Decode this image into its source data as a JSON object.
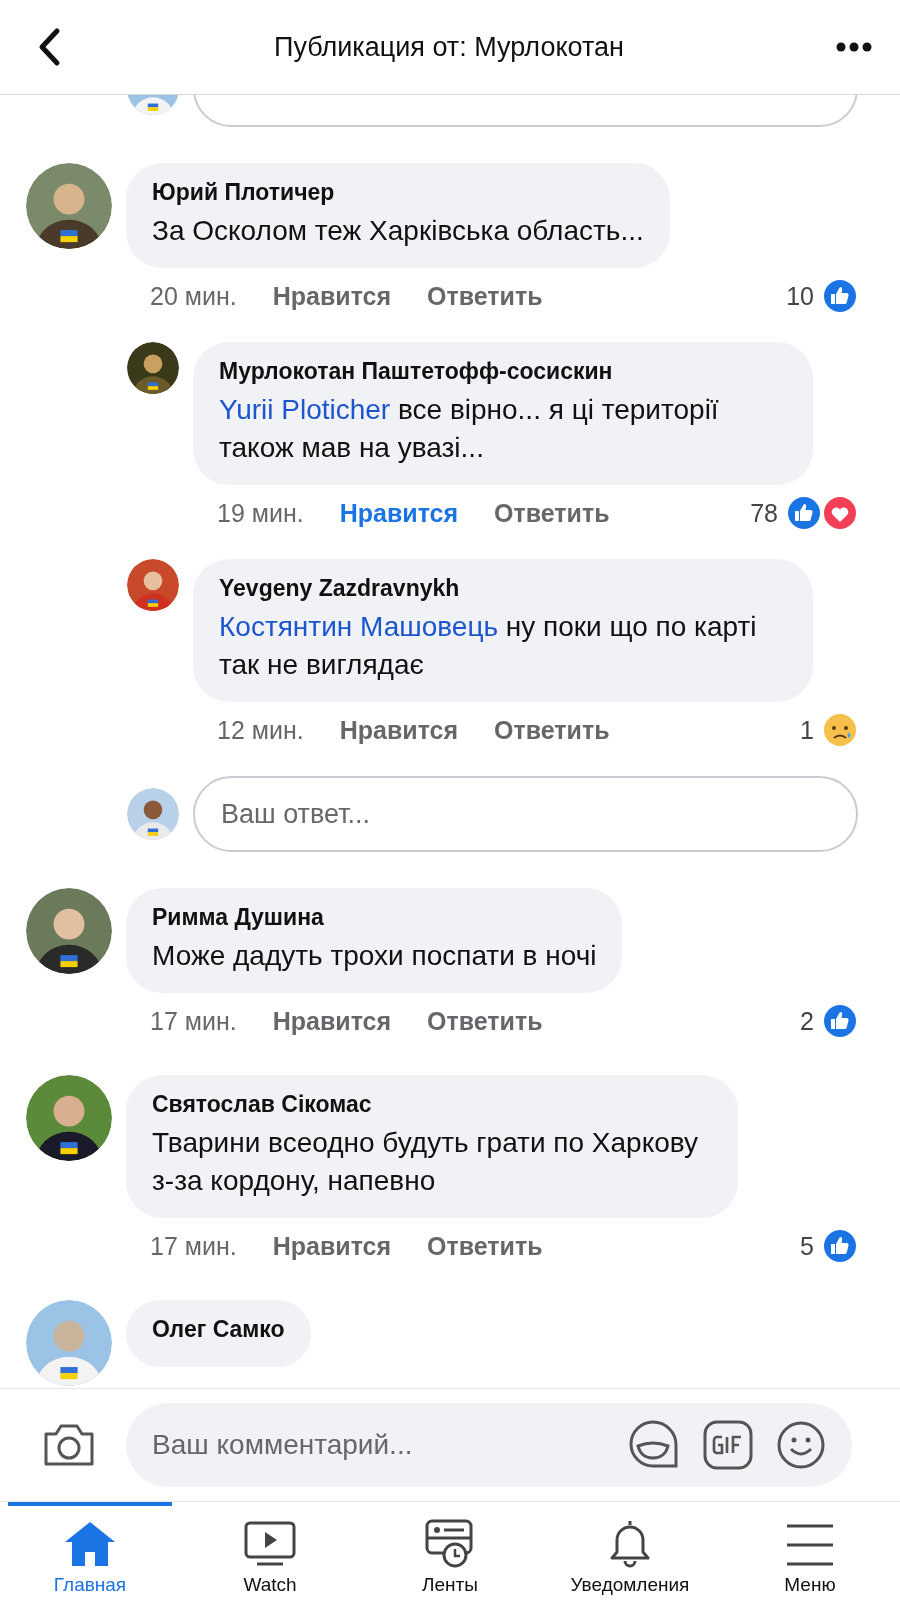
{
  "header": {
    "title": "Публикация от: Мурлокотан"
  },
  "feed": [
    {
      "kind": "reply_box"
    },
    {
      "kind": "comment",
      "author": "Юрий Плотичер",
      "text": "За Осколом теж Харківська область...",
      "time": "20 мин.",
      "like_label": "Нравится",
      "liked": false,
      "reply_label": "Ответить",
      "count": "10",
      "reactions": [
        {
          "kind": "like"
        }
      ],
      "replies": [
        {
          "author": "Мурлокотан Паштетофф-сосискин",
          "mention": "Yurii Ploticher",
          "text": "все вірно... я ці території також мав на увазі...",
          "time": "19 мин.",
          "like_label": "Нравится",
          "liked": true,
          "reply_label": "Ответить",
          "count": "78",
          "reactions": [
            {
              "kind": "like"
            },
            {
              "kind": "love"
            }
          ]
        },
        {
          "author": "Yevgeny Zazdravnykh",
          "mention": "Костянтин Машовець",
          "text": "ну поки що по карті так не виглядає",
          "time": "12 мин.",
          "like_label": "Нравится",
          "liked": false,
          "reply_label": "Ответить",
          "count": "1",
          "reactions": [
            {
              "kind": "sad"
            }
          ]
        }
      ]
    },
    {
      "kind": "reply_box",
      "placeholder": "Ваш ответ..."
    },
    {
      "kind": "comment",
      "author": "Римма Душина",
      "text": "Може дадуть трохи поспати в ночі",
      "time": "17 мин.",
      "like_label": "Нравится",
      "liked": false,
      "reply_label": "Ответить",
      "count": "2",
      "reactions": [
        {
          "kind": "like"
        }
      ]
    },
    {
      "kind": "comment",
      "author": "Святослав Сікомас",
      "text": "Тварини всеодно  будуть грати по Харкову з-за кордону, напевно",
      "time": "17 мин.",
      "like_label": "Нравится",
      "liked": false,
      "reply_label": "Ответить",
      "count": "5",
      "reactions": [
        {
          "kind": "like"
        }
      ]
    },
    {
      "kind": "comment",
      "author": "Олег Самко"
    }
  ],
  "composer": {
    "placeholder": "Ваш комментарий..."
  },
  "tabs": [
    {
      "label": "Главная",
      "selected": true
    },
    {
      "label": "Watch",
      "selected": false
    },
    {
      "label": "Ленты",
      "selected": false
    },
    {
      "label": "Уведомления",
      "selected": false
    },
    {
      "label": "Меню",
      "selected": false
    }
  ]
}
